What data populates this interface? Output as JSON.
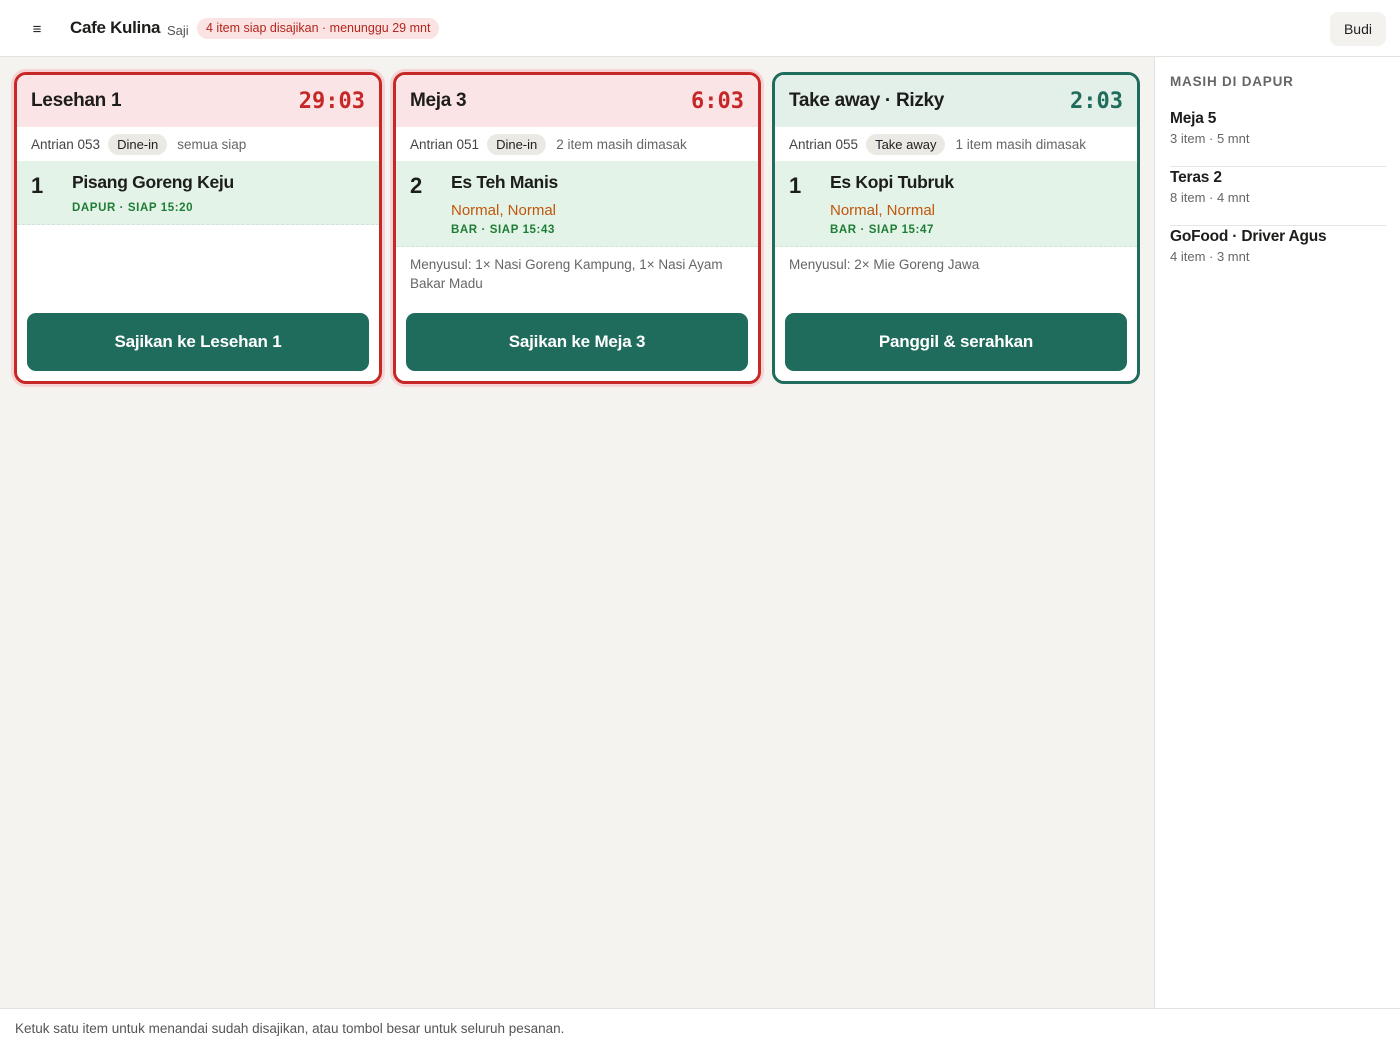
{
  "header": {
    "menu_icon": "≡",
    "brand": "Cafe Kulina",
    "mode": "Saji",
    "alert": "4 item siap disajikan · menunggu 29 mnt",
    "user": "Budi"
  },
  "cards": [
    {
      "title": "Lesehan 1",
      "timer": "29:03",
      "queue": "Antrian 053",
      "type": "Dine-in",
      "note": "semua siap",
      "items": [
        {
          "qty": "1",
          "name": "Pisang Goreng Keju",
          "modifiers": "",
          "status": "DAPUR · SIAP 15:20"
        }
      ],
      "follow": "",
      "action": "Sajikan ke Lesehan 1"
    },
    {
      "title": "Meja 3",
      "timer": "6:03",
      "queue": "Antrian 051",
      "type": "Dine-in",
      "note": "2 item masih dimasak",
      "items": [
        {
          "qty": "2",
          "name": "Es Teh Manis",
          "modifiers": "Normal, Normal",
          "status": "BAR · SIAP 15:43"
        }
      ],
      "follow": "Menyusul: 1× Nasi Goreng Kampung, 1× Nasi Ayam Bakar Madu",
      "action": "Sajikan ke Meja 3"
    },
    {
      "title": "Take away · Rizky",
      "timer": "2:03",
      "queue": "Antrian 055",
      "type": "Take away",
      "note": "1 item masih dimasak",
      "items": [
        {
          "qty": "1",
          "name": "Es Kopi Tubruk",
          "modifiers": "Normal, Normal",
          "status": "BAR · SIAP 15:47"
        }
      ],
      "follow": "Menyusul: 2× Mie Goreng Jawa",
      "action": "Panggil & serahkan"
    }
  ],
  "sidebar": {
    "title": "MASIH DI DAPUR",
    "items": [
      {
        "name": "Meja 5",
        "sub": "3 item · 5 mnt"
      },
      {
        "name": "Teras 2",
        "sub": "8 item · 4 mnt"
      },
      {
        "name": "GoFood · Driver Agus",
        "sub": "4 item · 3 mnt"
      }
    ]
  },
  "footer": {
    "hint": "Ketuk satu item untuk menandai sudah disajikan, atau tombol besar untuk seluruh pesanan."
  },
  "colors": {
    "urgent": "#c62828",
    "ok": "#1f6b5c",
    "ready_bg": "#e3f3e8",
    "modifier": "#c2560b"
  }
}
